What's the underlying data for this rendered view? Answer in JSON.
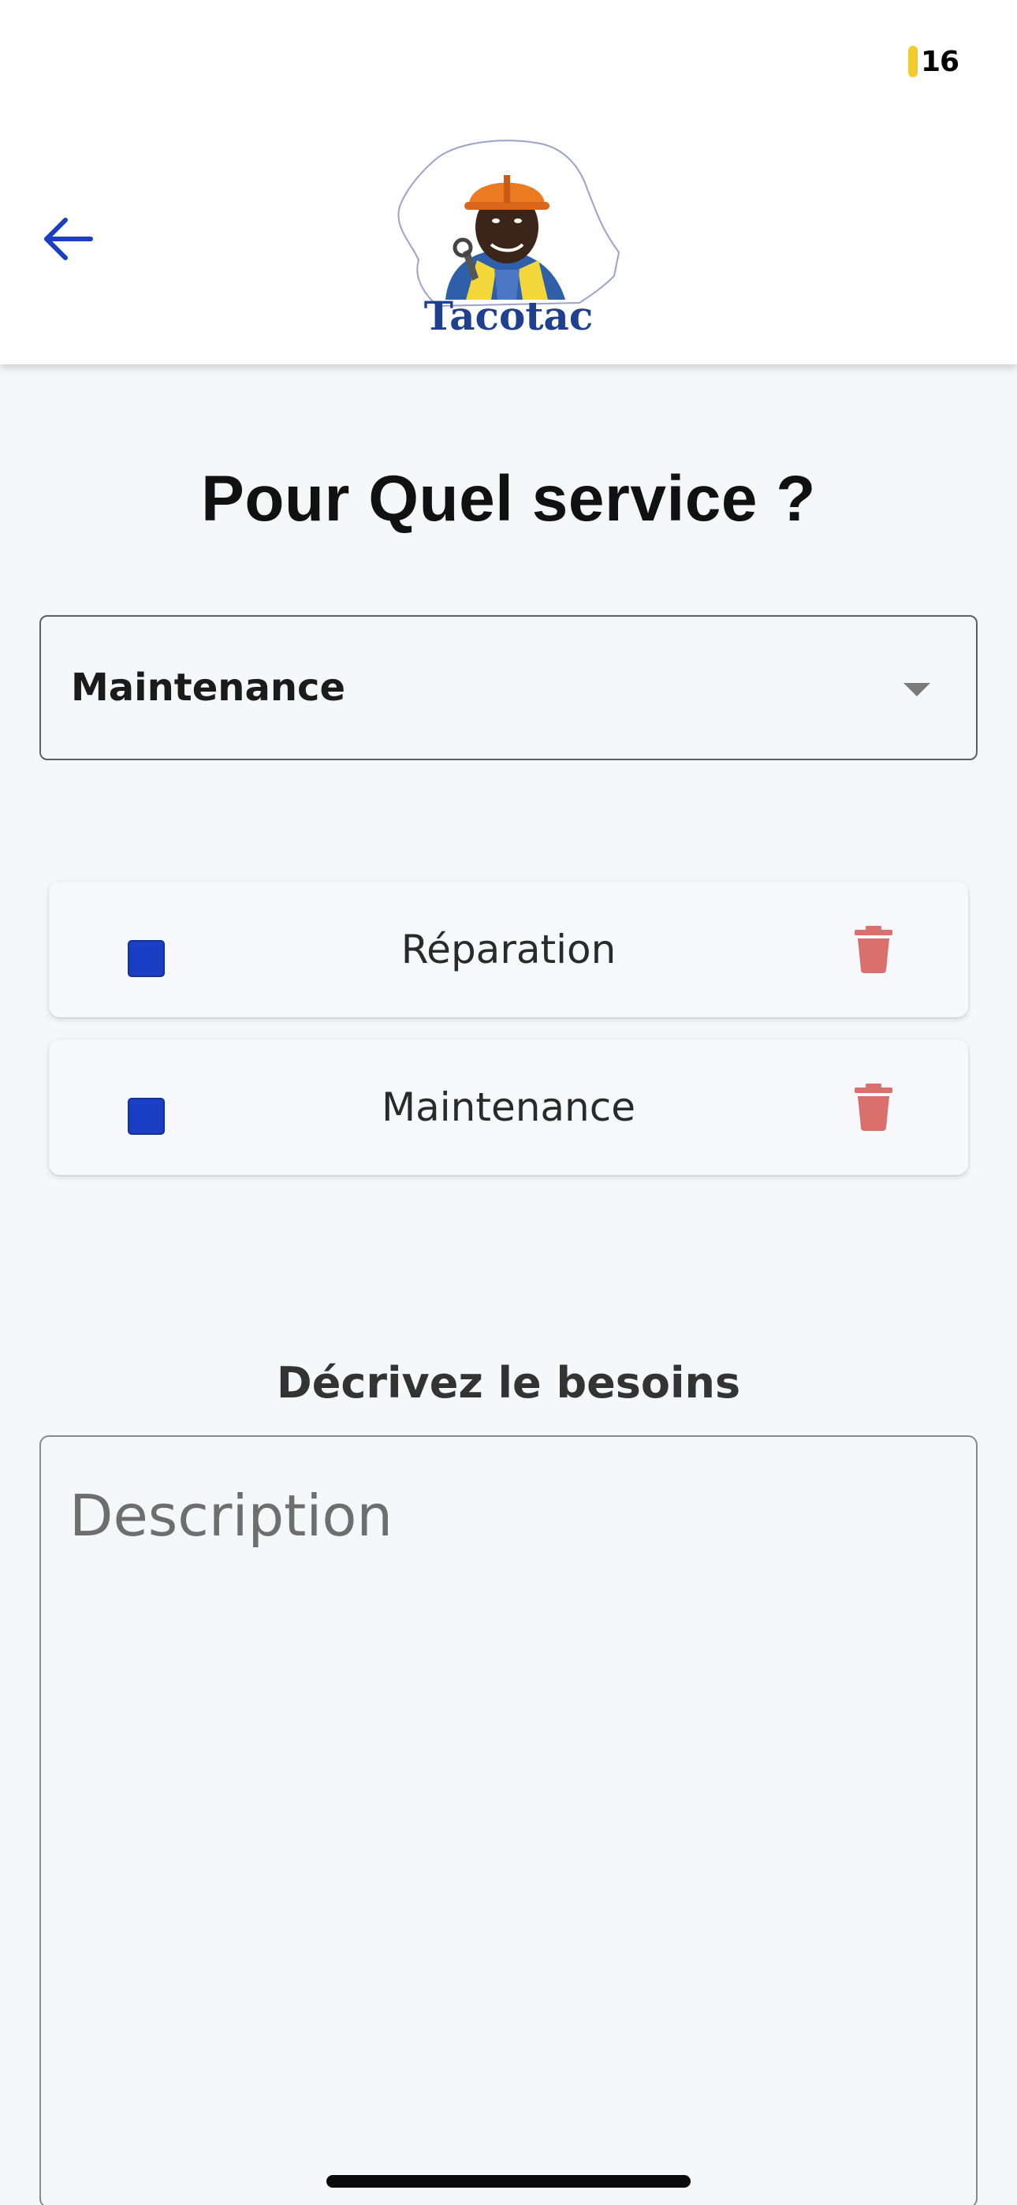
{
  "status": {
    "badge_number": "16",
    "badge_color": "#f2cc2e"
  },
  "header": {
    "back_icon": "arrow-left-icon",
    "logo_text": "Tacotac",
    "accent_color": "#1a3ec4"
  },
  "title": "Pour Quel service ?",
  "service_select": {
    "selected": "Maintenance"
  },
  "services": [
    {
      "label": "Réparation",
      "checked": true,
      "delete_icon": "trash-icon"
    },
    {
      "label": "Maintenance",
      "checked": true,
      "delete_icon": "trash-icon"
    }
  ],
  "description": {
    "heading": "Décrivez le besoins",
    "placeholder": "Description",
    "value": ""
  },
  "colors": {
    "checkbox": "#1a3ec4",
    "trash": "#d9706e",
    "background": "#f6f7fa"
  }
}
